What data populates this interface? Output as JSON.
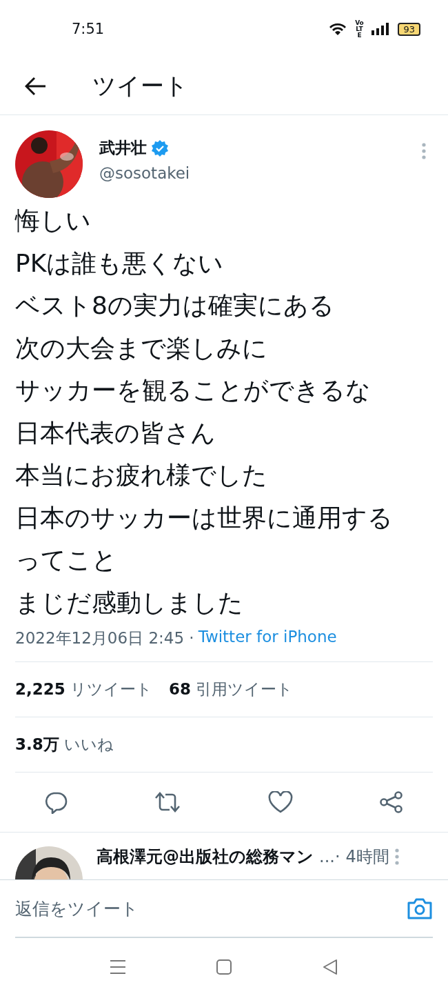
{
  "status_bar": {
    "time": "7:51",
    "network": "Vo LTE",
    "battery": "93"
  },
  "header": {
    "title": "ツイート"
  },
  "tweet": {
    "author": {
      "name": "武井壮",
      "handle": "@sosotakei",
      "verified": true
    },
    "lines": [
      "悔しい",
      "PKは誰も悪くない",
      "ベスト8の実力は確実にある",
      "次の大会まで楽しみに",
      "サッカーを観ることができるな",
      "日本代表の皆さん",
      "本当にお疲れ様でした",
      "日本のサッカーは世界に通用する",
      "ってこと",
      "まじだ感動しました"
    ],
    "timestamp": "2022年12月06日 2:45 ·",
    "source": "Twitter for iPhone",
    "stats": [
      {
        "count": "2,225",
        "label": "リツイート"
      },
      {
        "count": "68",
        "label": "引用ツイート"
      }
    ],
    "likes": {
      "count": "3.8万",
      "label": "いいね"
    }
  },
  "reply": {
    "name": "高根澤元@出版社の総務マン",
    "ellipsis": "...·",
    "time": "4時間"
  },
  "composer": {
    "placeholder": "返信をツイート"
  }
}
